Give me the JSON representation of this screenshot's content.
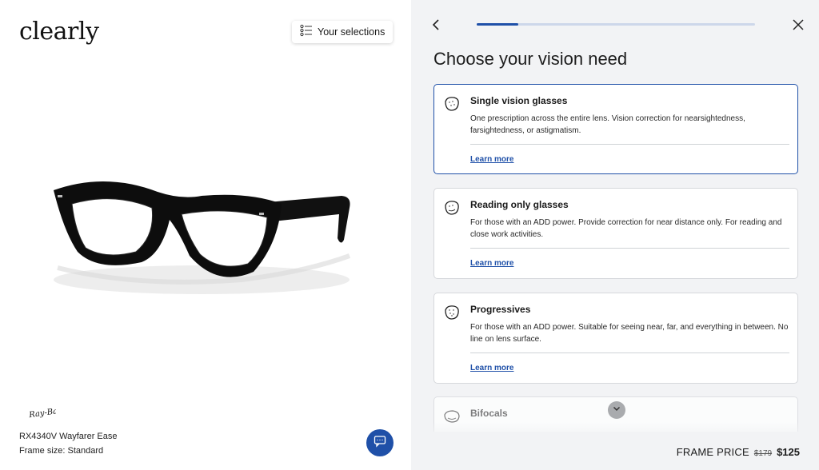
{
  "brand": {
    "logo_text": "clearly"
  },
  "selections_button": {
    "label": "Your selections"
  },
  "product": {
    "brand_logo_text": "Ray-Ban",
    "name": "RX4340V Wayfarer Ease",
    "frame_size": "Frame size: Standard"
  },
  "progress": {
    "fraction": 0.15
  },
  "page_title": "Choose your vision need",
  "options": [
    {
      "title": "Single vision glasses",
      "description": "One prescription across the entire lens. Vision correction for nearsightedness, farsightedness, or astigmatism.",
      "link": "Learn more",
      "selected": true
    },
    {
      "title": "Reading only glasses",
      "description": "For those with an ADD power. Provide correction for near distance only. For reading and close work activities.",
      "link": "Learn more",
      "selected": false
    },
    {
      "title": "Progressives",
      "description": "For those with an ADD power. Suitable for seeing near, far, and everything in between. No line on lens surface.",
      "link": "Learn more",
      "selected": false
    },
    {
      "title": "Bifocals",
      "selected": false
    }
  ],
  "price": {
    "label": "FRAME PRICE",
    "original": "$179",
    "current": "$125"
  },
  "colors": {
    "accent": "#1f50a8",
    "panel_bg": "#f2f3f5"
  }
}
